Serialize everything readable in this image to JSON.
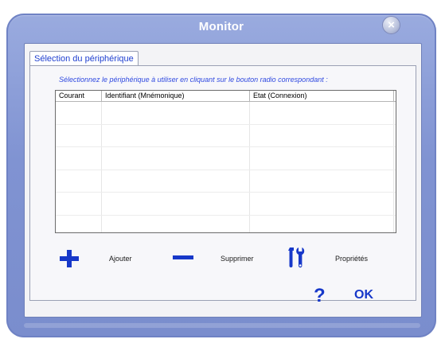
{
  "window": {
    "title": "Monitor"
  },
  "tab": {
    "label": "Sélection du périphérique"
  },
  "instruction": "Sélectionnez le périphérique à utiliser en cliquant sur le bouton radio correspondant :",
  "table": {
    "columns": [
      "Courant",
      "Identifiant (Mnémonique)",
      "Etat (Connexion)"
    ],
    "rows": [
      [],
      [],
      [],
      [],
      [],
      []
    ]
  },
  "actions": {
    "add_label": "Ajouter",
    "remove_label": "Supprimer",
    "properties_label": "Propriétés",
    "help_glyph": "?",
    "ok_label": "OK"
  },
  "colors": {
    "window_frame": "#8093d2",
    "accent_blue": "#1738c9",
    "instruction_text": "#2f49e0"
  },
  "icons": [
    "close-icon",
    "plus-icon",
    "minus-icon",
    "tools-icon",
    "help-icon"
  ]
}
